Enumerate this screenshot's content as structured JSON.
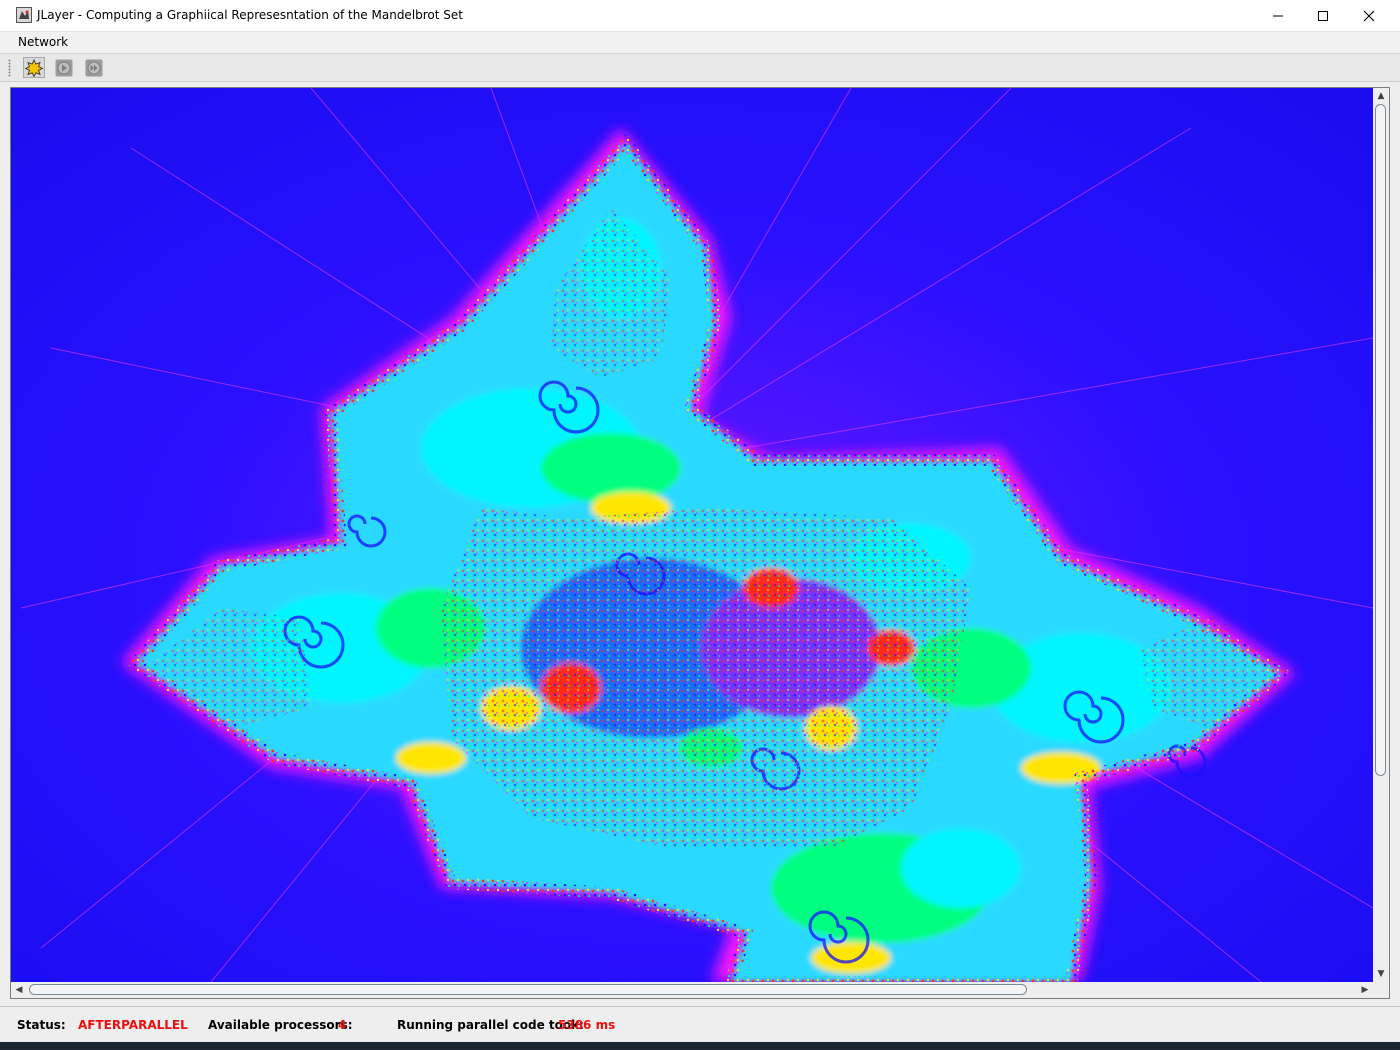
{
  "window": {
    "title": "JLayer - Computing a Graphiical Represesntation of the Mandelbrot Set",
    "controls": {
      "minimize": "minimize-icon",
      "maximize": "maximize-icon",
      "close": "close-icon"
    }
  },
  "menubar": {
    "items": [
      {
        "label": "Network"
      }
    ]
  },
  "toolbar": {
    "buttons": [
      "compute-icon",
      "play-icon",
      "fast-forward-icon"
    ]
  },
  "canvas": {
    "content": "mandelbrot-fractal",
    "colors": {
      "background": "#1a10ff",
      "magenta": "#ff19ff",
      "cyan": "#00f5ff",
      "green": "#00ff80",
      "yellow": "#ffe600",
      "red": "#ff2a1a"
    }
  },
  "status": {
    "status_label": "Status:",
    "status_value": "AFTERPARALLEL",
    "processors_label": "Available processors:",
    "processors_value": "4",
    "time_label": "Running parallel code took:",
    "time_value": "5386 ms",
    "value_color": "#e8110f"
  }
}
